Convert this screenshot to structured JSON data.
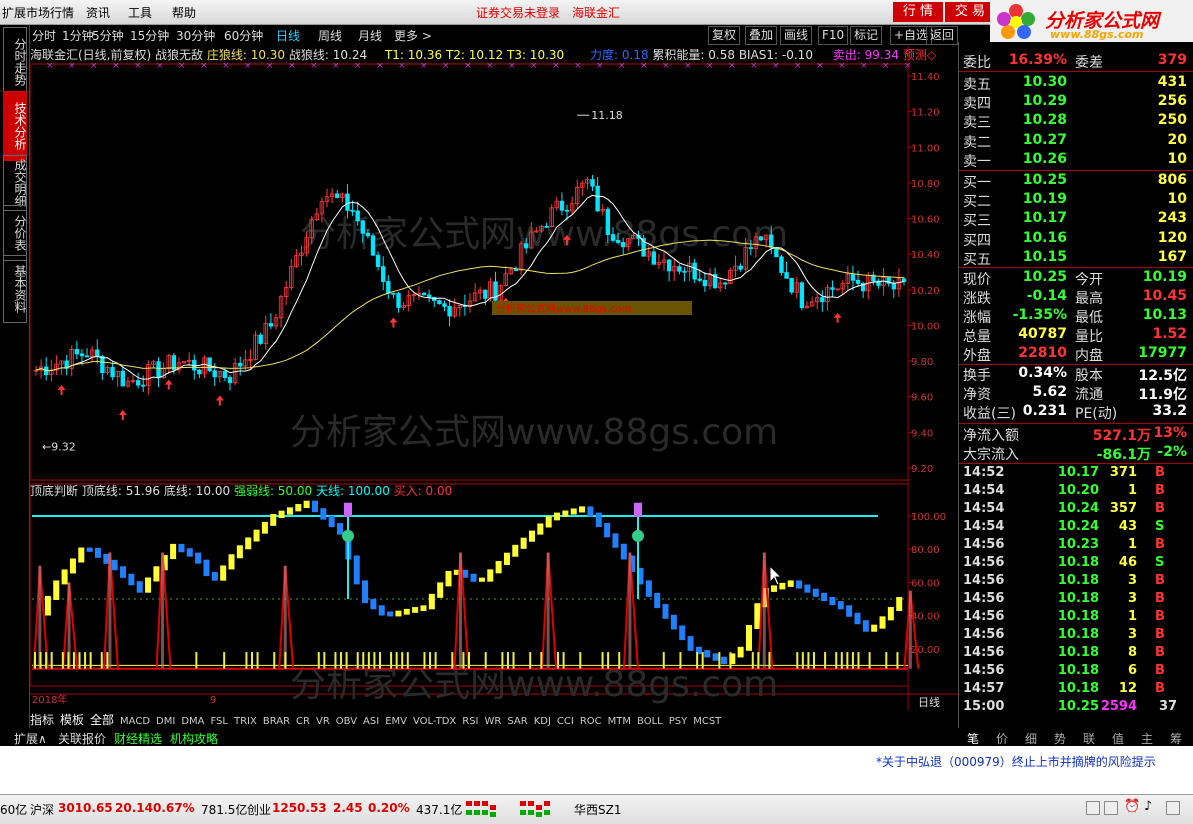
{
  "menu": {
    "items": [
      "扩展市场行情",
      "资讯",
      "工具",
      "帮助"
    ],
    "alerts": [
      "证券交易未登录",
      "海联金汇"
    ],
    "buttons": [
      "行 情",
      "交 易"
    ]
  },
  "logo": {
    "title": "分析家公式网",
    "url": "www.88gs.com"
  },
  "periods": [
    "分时",
    "1分钟",
    "5分钟",
    "15分钟",
    "30分钟",
    "60分钟",
    "日线",
    "周线",
    "月线",
    "更多 >"
  ],
  "active_period": "日线",
  "tools": [
    "复权",
    "叠加",
    "画线",
    "F10",
    "标记",
    "+自选",
    "返回"
  ],
  "left_tabs": [
    "分时走势",
    "技术分析",
    "成交明细",
    "分价表",
    "基本资料"
  ],
  "main_info": {
    "name": "海联金汇(日线,前复权)",
    "indicator": "战狼无敌",
    "zhuanglang": "庄狼线: 10.30",
    "zhanlang": "战狼线: 10.24",
    "t1": "T1: 10.36",
    "t2": "T2: 10.12",
    "t3": "T3: 10.30",
    "lidu": "力度: 0.18",
    "leiji": "累积能量: 0.58",
    "bias": "BIAS1: -0.10",
    "maichu": "卖出: 99.34",
    "yuce": "预测◇"
  },
  "sub_info": {
    "name": "顶底判断",
    "d1": "顶底线: 51.96",
    "d2": "底线: 10.00",
    "d3": "强弱线: 50.00",
    "d4": "天线: 100.00",
    "d5": "买入: 0.00"
  },
  "price_axis": [
    "11.40",
    "11.20",
    "11.00",
    "10.80",
    "10.60",
    "10.40",
    "10.20",
    "10.00",
    "9.80",
    "9.60",
    "9.40",
    "9.20"
  ],
  "sub_axis": [
    "100.00",
    "80.00",
    "60.00",
    "40.00",
    "20.00"
  ],
  "annotations": {
    "high": "11.18",
    "low": "9.32",
    "year": "2018年",
    "month": "9",
    "watermark": "分析家公式网www.88gs.com",
    "box": "分析家公式网www.88gs.com"
  },
  "period_label": "日线",
  "zoom": [
    "+",
    "-",
    "0"
  ],
  "indicator_tabs": [
    "指标",
    "模板",
    "全部",
    "MACD",
    "DMI",
    "DMA",
    "FSL",
    "TRIX",
    "BRAR",
    "CR",
    "VR",
    "OBV",
    "ASI",
    "EMV",
    "VOL-TDX",
    "RSI",
    "WR",
    "SAR",
    "KDJ",
    "CCI",
    "ROC",
    "MTM",
    "BOLL",
    "PSY",
    "MCST"
  ],
  "bottom_tabs": [
    "扩展∧",
    "关联报价",
    "财经精选",
    "机构攻略"
  ],
  "news": "*关于中弘退（000979）终止上市并摘牌的风险提示",
  "status": {
    "c0": "60亿",
    "sh_name": "沪深",
    "sh_val": "3010.65",
    "sh_chg": "20.14",
    "sh_pct": "0.67%",
    "sh_amt": "781.5亿",
    "cy_name": "创业",
    "cy_val": "1250.53",
    "cy_chg": "2.45",
    "cy_pct": "0.20%",
    "cy_amt": "437.1亿",
    "site": "华西SZ1"
  },
  "right": {
    "weibi": {
      "label": "委比",
      "val": "16.39%",
      "label2": "委差",
      "val2": "379"
    },
    "sell": [
      {
        "label": "卖五",
        "price": "10.30",
        "vol": "431"
      },
      {
        "label": "卖四",
        "price": "10.29",
        "vol": "256"
      },
      {
        "label": "卖三",
        "price": "10.28",
        "vol": "250"
      },
      {
        "label": "卖二",
        "price": "10.27",
        "vol": "20"
      },
      {
        "label": "卖一",
        "price": "10.26",
        "vol": "10"
      }
    ],
    "buy": [
      {
        "label": "买一",
        "price": "10.25",
        "vol": "806"
      },
      {
        "label": "买二",
        "price": "10.19",
        "vol": "10"
      },
      {
        "label": "买三",
        "price": "10.17",
        "vol": "243"
      },
      {
        "label": "买四",
        "price": "10.16",
        "vol": "120"
      },
      {
        "label": "买五",
        "price": "10.15",
        "vol": "167"
      }
    ],
    "quote": [
      {
        "l1": "现价",
        "v1": "10.25",
        "c1": "#3f3",
        "l2": "今开",
        "v2": "10.19",
        "c2": "#3f3"
      },
      {
        "l1": "涨跌",
        "v1": "-0.14",
        "c1": "#3f3",
        "l2": "最高",
        "v2": "10.45",
        "c2": "#f33"
      },
      {
        "l1": "涨幅",
        "v1": "-1.35%",
        "c1": "#3f3",
        "l2": "最低",
        "v2": "10.13",
        "c2": "#3f3"
      },
      {
        "l1": "总量",
        "v1": "40787",
        "c1": "#ff4",
        "l2": "量比",
        "v2": "1.52",
        "c2": "#f33"
      },
      {
        "l1": "外盘",
        "v1": "22810",
        "c1": "#f33",
        "l2": "内盘",
        "v2": "17977",
        "c2": "#3f3"
      }
    ],
    "fund": [
      {
        "l1": "换手",
        "v1": "0.34%",
        "l2": "股本",
        "v2": "12.5亿"
      },
      {
        "l1": "净资",
        "v1": "5.62",
        "l2": "流通",
        "v2": "11.9亿"
      },
      {
        "l1": "收益(三)",
        "v1": "0.231",
        "l2": "PE(动)",
        "v2": "33.2"
      }
    ],
    "flow": [
      {
        "label": "净流入额",
        "val": "527.1万",
        "pct": "13%",
        "color": "#f33"
      },
      {
        "label": "大宗流入",
        "val": "-86.1万",
        "pct": "-2%",
        "color": "#3f3"
      }
    ],
    "ticks": [
      {
        "t": "14:52",
        "p": "10.17",
        "v": "371",
        "s": "B"
      },
      {
        "t": "14:54",
        "p": "10.20",
        "v": "1",
        "s": "B"
      },
      {
        "t": "14:54",
        "p": "10.24",
        "v": "357",
        "s": "B"
      },
      {
        "t": "14:54",
        "p": "10.24",
        "v": "43",
        "s": "S"
      },
      {
        "t": "14:56",
        "p": "10.23",
        "v": "1",
        "s": "B"
      },
      {
        "t": "14:56",
        "p": "10.18",
        "v": "46",
        "s": "S"
      },
      {
        "t": "14:56",
        "p": "10.18",
        "v": "3",
        "s": "B"
      },
      {
        "t": "14:56",
        "p": "10.18",
        "v": "3",
        "s": "B"
      },
      {
        "t": "14:56",
        "p": "10.18",
        "v": "1",
        "s": "B"
      },
      {
        "t": "14:56",
        "p": "10.18",
        "v": "3",
        "s": "B"
      },
      {
        "t": "14:56",
        "p": "10.18",
        "v": "8",
        "s": "B"
      },
      {
        "t": "14:56",
        "p": "10.18",
        "v": "6",
        "s": "B"
      },
      {
        "t": "14:57",
        "p": "10.18",
        "v": "12",
        "s": "B"
      },
      {
        "t": "15:00",
        "p": "10.25",
        "v": "2594",
        "s": "37"
      }
    ],
    "footer_tabs": [
      "笔",
      "价",
      "细",
      "势",
      "联",
      "值",
      "主",
      "筹"
    ]
  },
  "colors": {
    "up": "#ff3a3a",
    "down": "#00e5ff",
    "ma": "#ffffff",
    "ma2": "#f0e060",
    "red": "#e00000",
    "yellow": "#ffff33",
    "blue": "#2080ff"
  }
}
